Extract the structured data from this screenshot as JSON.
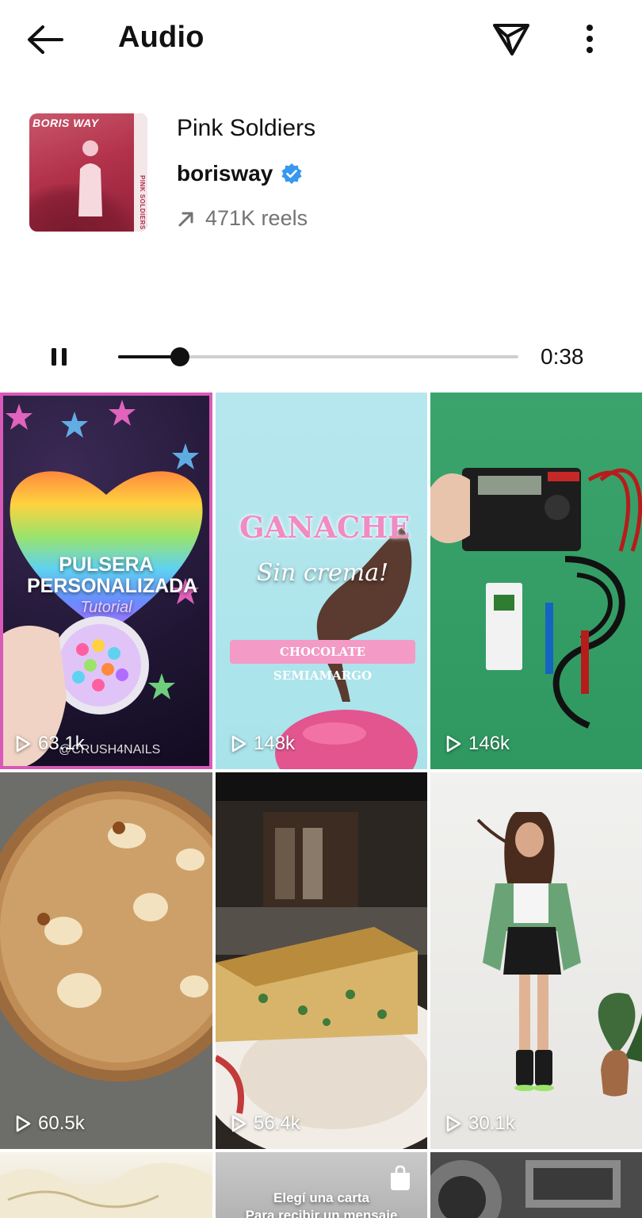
{
  "header": {
    "title": "Audio",
    "back_icon": "back-arrow-icon",
    "share_icon": "send-icon",
    "more_icon": "more-vertical-icon"
  },
  "track": {
    "name": "Pink Soldiers",
    "artist": "borisway",
    "verified": true,
    "reels_count": "471K reels",
    "cover_brand": "BORIS WAY",
    "cover_side_text": "PINK SOLDIERS",
    "accent_color": "#3897f0"
  },
  "player": {
    "state": "playing",
    "time": "0:38",
    "progress_fraction": 0.155
  },
  "reels": [
    {
      "views": "63.1k",
      "overlay_title": "PULSERA PERSONALIZADA",
      "overlay_sub": "Tutorial",
      "watermark": "@CRUSH4NAILS"
    },
    {
      "views": "148k",
      "overlay_title": "GANACHE",
      "overlay_sub": "Sin crema!",
      "badge": "CHOCOLATE SEMIAMARGO"
    },
    {
      "views": "146k"
    },
    {
      "views": "60.5k"
    },
    {
      "views": "56.4k"
    },
    {
      "views": "30.1k"
    },
    {
      "views": ""
    },
    {
      "views": "",
      "overlay_title": "Elegí una carta",
      "overlay_sub": "Para recibir un mensaje"
    },
    {
      "views": ""
    }
  ]
}
